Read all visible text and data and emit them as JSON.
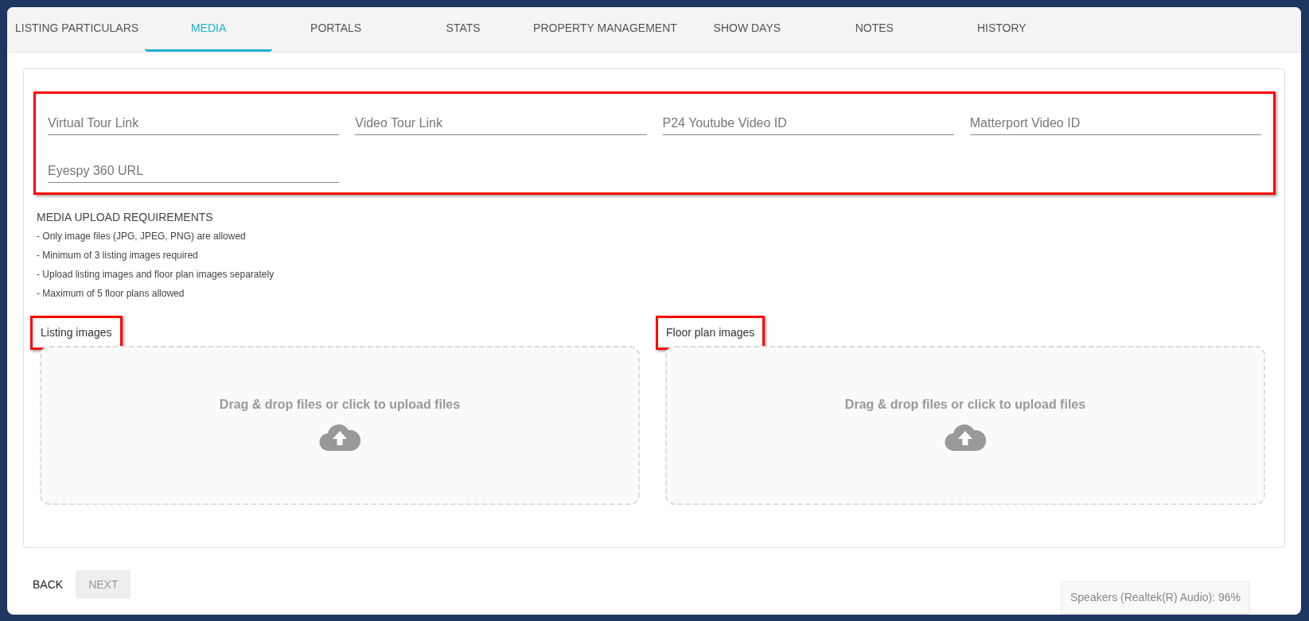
{
  "tabs": [
    {
      "label": "LISTING PARTICULARS",
      "selected": false
    },
    {
      "label": "MEDIA",
      "selected": true
    },
    {
      "label": "PORTALS",
      "selected": false
    },
    {
      "label": "STATS",
      "selected": false
    },
    {
      "label": "PROPERTY MANAGEMENT",
      "selected": false
    },
    {
      "label": "SHOW DAYS",
      "selected": false
    },
    {
      "label": "NOTES",
      "selected": false
    },
    {
      "label": "HISTORY",
      "selected": false
    }
  ],
  "link_fields": {
    "highlighted": true,
    "fields": [
      {
        "placeholder": "Virtual Tour Link"
      },
      {
        "placeholder": "Video Tour Link"
      },
      {
        "placeholder": "P24 Youtube Video ID"
      },
      {
        "placeholder": "Matterport Video ID"
      },
      {
        "placeholder": "Eyespy 360 URL"
      }
    ]
  },
  "requirements": {
    "title": "MEDIA UPLOAD REQUIREMENTS",
    "lines": [
      "- Only image files (JPG, JPEG, PNG) are allowed",
      "- Minimum of 3 listing images required",
      "- Upload listing images and floor plan images separately",
      "- Maximum of 5 floor plans allowed"
    ]
  },
  "uploads": [
    {
      "label": "Listing images",
      "highlighted": true,
      "prompt": "Drag & drop files or click to upload files"
    },
    {
      "label": "Floor plan images",
      "highlighted": true,
      "prompt": "Drag & drop files or click to upload files"
    }
  ],
  "buttons": [
    {
      "label": "BACK",
      "disabled": false
    },
    {
      "label": "NEXT",
      "disabled": true
    }
  ],
  "toast": "Speakers (Realtek(R) Audio): 96%"
}
